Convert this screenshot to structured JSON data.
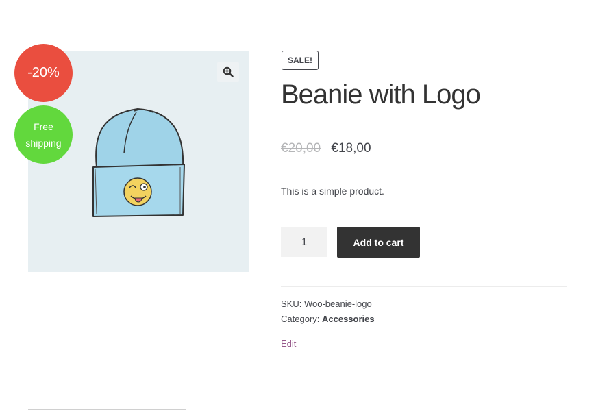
{
  "gallery": {
    "image_alt": "Beanie with Logo product image",
    "zoom_icon": "magnifier-plus-icon"
  },
  "badges": {
    "discount": "-20%",
    "free_shipping": "Free shipping"
  },
  "product": {
    "sale_label": "SALE!",
    "title": "Beanie with Logo",
    "price_old": "€20,00",
    "price_new": "€18,00",
    "description": "This is a simple product."
  },
  "cart": {
    "quantity": "1",
    "add_to_cart_label": "Add to cart"
  },
  "meta": {
    "sku_label": "SKU:",
    "sku_value": "Woo-beanie-logo",
    "category_label": "Category:",
    "category_value": "Accessories"
  },
  "edit_label": "Edit",
  "colors": {
    "discount_badge": "#ea4e3f",
    "shipping_badge": "#62d83d",
    "button": "#333333",
    "edit_link": "#96588a",
    "image_bg": "#e7eff2"
  }
}
